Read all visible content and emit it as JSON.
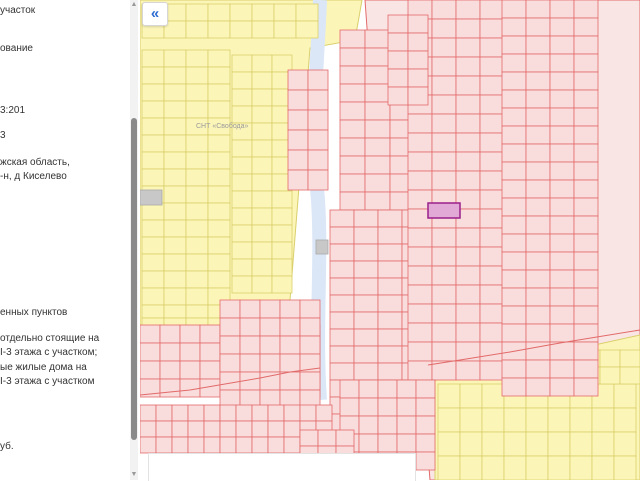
{
  "info_panel": {
    "lines": [
      "участок",
      "ование",
      "3:201",
      "3",
      "жская область,",
      "-н, д Киселево",
      "енных пунктов",
      "отдельно стоящие на",
      "I-3 этажа с участком;",
      "ые жилые дома на",
      "I-3 этажа с участком",
      "уб."
    ]
  },
  "map": {
    "collapse_icon": "«",
    "cluster_label": "СНТ «Свобода»",
    "colors": {
      "yellow_fill": "#fcf5b8",
      "yellow_stroke": "#d9cf6a",
      "pink_fill": "#f9dcdc",
      "pink_stroke": "#e26a6a",
      "pink_bg": "#fae5e5",
      "selected_fill": "#e2a9d6",
      "selected_stroke": "#9b1f8c",
      "river": "#a8ccf0",
      "stream": "#dbe7f7"
    }
  },
  "scrollbar": {
    "up_icon": "▲",
    "down_icon": "▼"
  }
}
